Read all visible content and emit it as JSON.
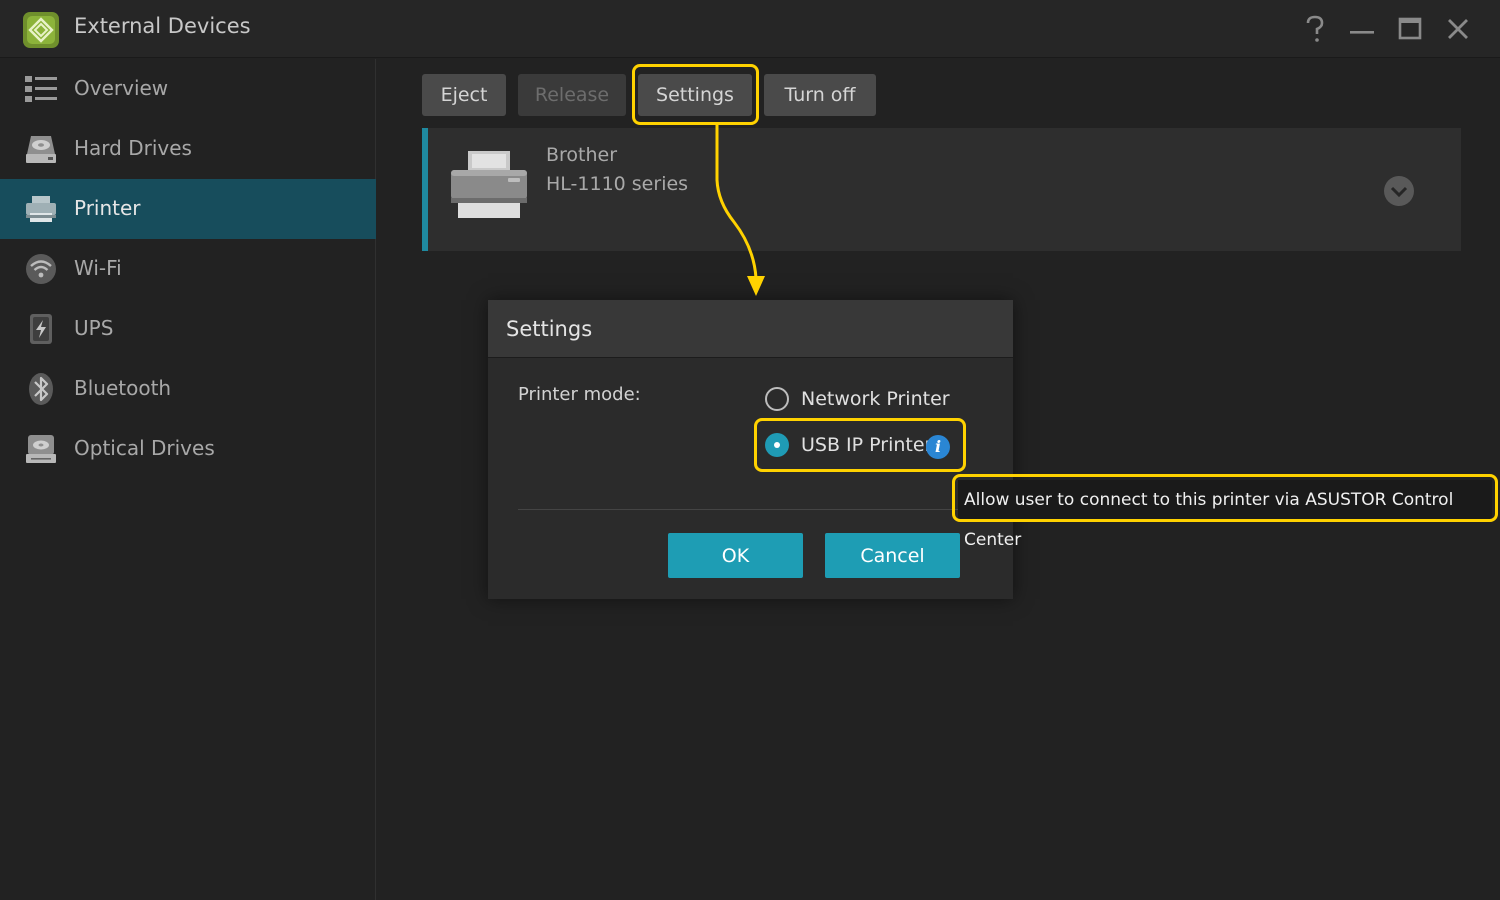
{
  "window": {
    "title": "External Devices",
    "icons": [
      "help-icon",
      "minimize-icon",
      "maximize-icon",
      "close-icon"
    ]
  },
  "sidebar": {
    "items": [
      {
        "label": "Overview",
        "icon": "list-icon"
      },
      {
        "label": "Hard Drives",
        "icon": "hard-drive-icon"
      },
      {
        "label": "Printer",
        "icon": "printer-icon",
        "active": true
      },
      {
        "label": "Wi-Fi",
        "icon": "wifi-icon"
      },
      {
        "label": "UPS",
        "icon": "ups-icon"
      },
      {
        "label": "Bluetooth",
        "icon": "bluetooth-icon"
      },
      {
        "label": "Optical Drives",
        "icon": "optical-drive-icon"
      }
    ]
  },
  "toolbar": {
    "eject": "Eject",
    "release": "Release",
    "settings": "Settings",
    "turn_off": "Turn off"
  },
  "device": {
    "brand": "Brother",
    "model": "HL-1110 series"
  },
  "dialog": {
    "title": "Settings",
    "mode_label": "Printer mode:",
    "options": [
      {
        "label": "Network Printer",
        "selected": false
      },
      {
        "label": "USB IP Printer",
        "selected": true
      }
    ],
    "info_glyph": "i",
    "ok": "OK",
    "cancel": "Cancel"
  },
  "tooltip": {
    "text": "Allow user to connect to this printer via ASUSTOR Control Center"
  },
  "colors": {
    "accent": "#1f9bb5",
    "highlight": "#ffd200",
    "active_nav": "#174d5c"
  }
}
